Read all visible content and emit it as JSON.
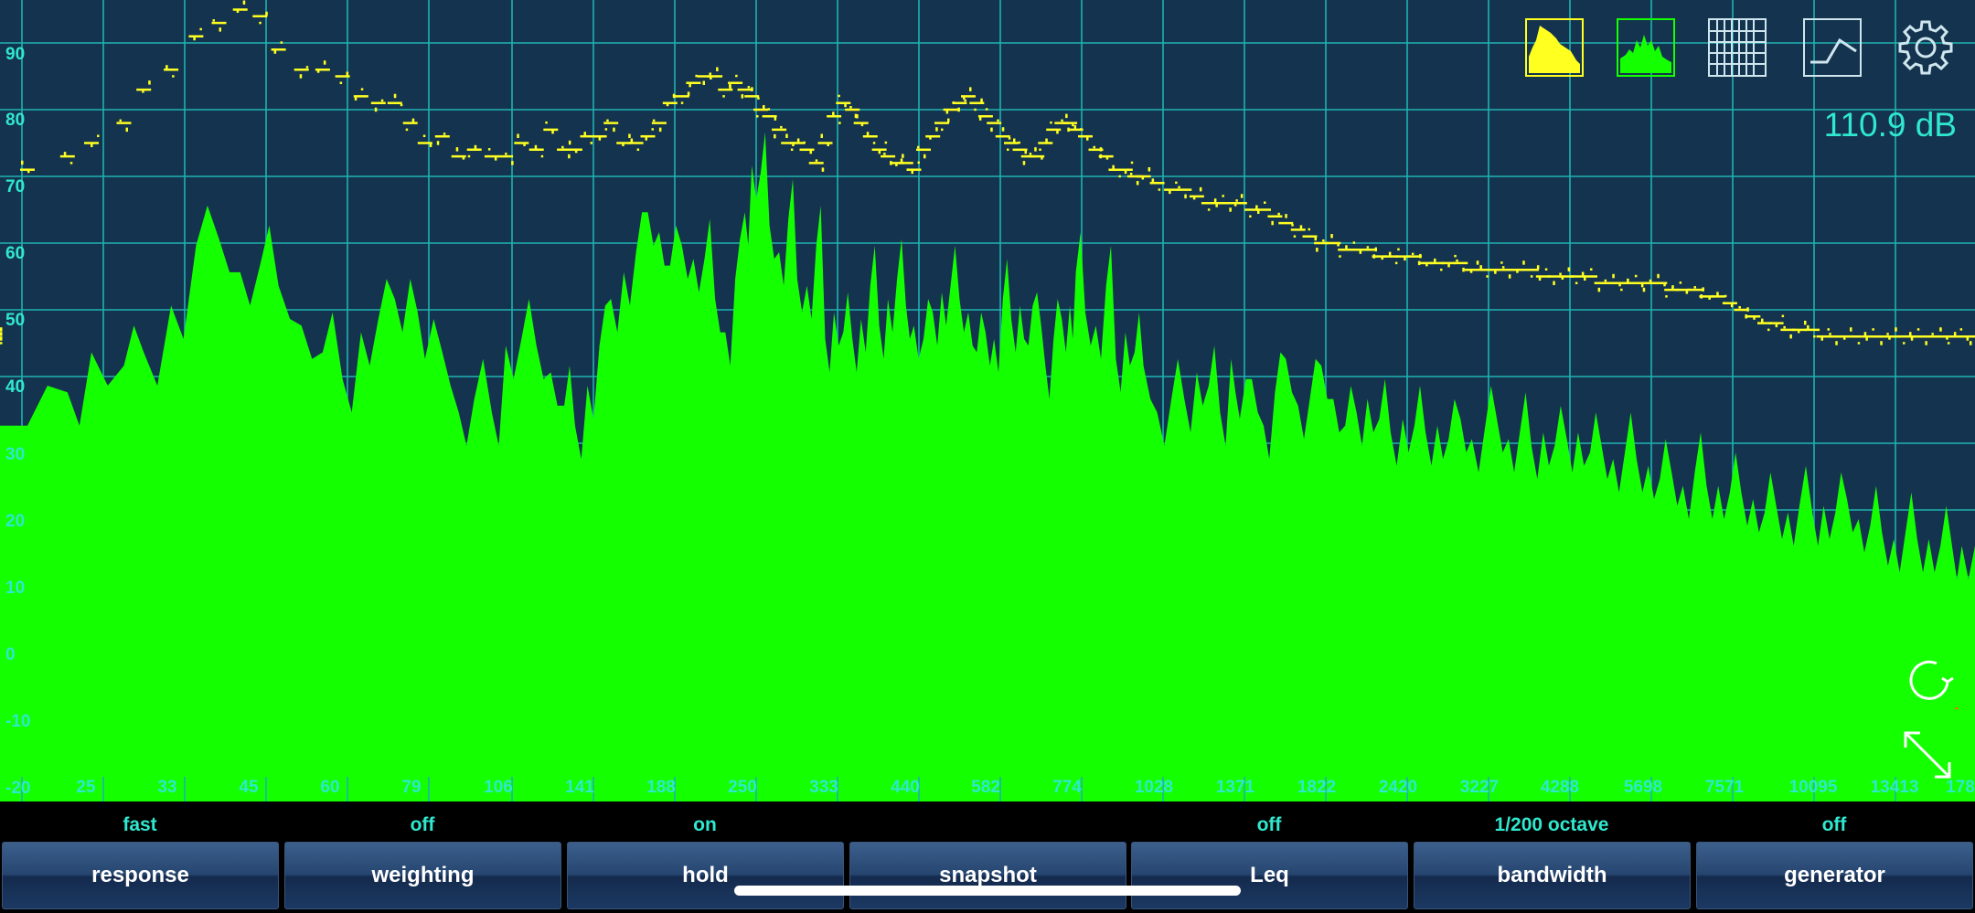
{
  "colors": {
    "background": "#14334f",
    "grid": "#1fb3b0",
    "spectrum": "#14ff00",
    "peak_hold": "#ffff20",
    "label": "#2fe8cf"
  },
  "toolbar": {
    "icons": [
      {
        "name": "yellow-spectrum-icon"
      },
      {
        "name": "green-spectrum-icon"
      },
      {
        "name": "grid-icon"
      },
      {
        "name": "curve-icon"
      },
      {
        "name": "gear-icon"
      }
    ],
    "db_readout": "110.9 dB"
  },
  "controls": {
    "icons": [
      {
        "name": "reset-icon"
      },
      {
        "name": "expand-icon"
      }
    ]
  },
  "chart_data": {
    "type": "area",
    "y_ticks": [
      "90",
      "80",
      "70",
      "60",
      "50",
      "40",
      "30",
      "20",
      "10",
      "0",
      "-10",
      "-20"
    ],
    "x_ticks": [
      "25",
      "33",
      "45",
      "60",
      "79",
      "106",
      "141",
      "188",
      "250",
      "333",
      "440",
      "582",
      "774",
      "1028",
      "1371",
      "1822",
      "2420",
      "3227",
      "4288",
      "5698",
      "7571",
      "10095",
      "13413",
      "178"
    ],
    "ylim": [
      -20,
      95
    ],
    "grid": true,
    "series": [
      {
        "x": [
          20,
          23,
          25,
          28,
          30,
          33,
          36,
          39,
          42,
          45,
          48,
          52,
          56,
          60,
          64,
          68,
          72,
          76,
          80,
          85,
          90,
          95,
          101,
          106,
          112,
          118,
          124,
          130,
          135,
          141,
          147,
          153,
          160,
          167,
          174,
          181,
          188,
          196,
          204,
          212,
          220,
          228,
          236,
          244,
          250,
          258,
          266,
          275,
          284,
          293,
          303,
          313,
          323,
          333,
          344,
          355,
          366,
          378,
          390,
          402,
          415,
          428,
          440,
          455,
          470,
          485,
          500,
          516,
          532,
          548,
          565,
          582,
          600,
          618,
          637,
          656,
          676,
          696,
          716,
          737,
          758,
          774,
          800,
          830,
          860,
          890,
          920,
          950,
          980,
          1028,
          1080,
          1130,
          1180,
          1230,
          1280,
          1330,
          1371,
          1430,
          1490,
          1550,
          1610,
          1680,
          1750,
          1822,
          1900,
          1980,
          2060,
          2140,
          2230,
          2320,
          2420,
          2520,
          2620,
          2730,
          2840,
          2960,
          3080,
          3227,
          3360,
          3500,
          3640,
          3790,
          3950,
          4110,
          4288,
          4460,
          4650,
          4840,
          5040,
          5250,
          5470,
          5698,
          5930,
          6180,
          6430,
          6700,
          6980,
          7270,
          7571,
          7880,
          8210,
          8550,
          8900,
          9270,
          9650,
          10095,
          10500,
          10940,
          11390,
          11860,
          12350,
          12870,
          13413,
          13970,
          14550,
          15150,
          15780,
          16430,
          17000,
          17800
        ],
        "values": [
          34,
          39,
          45,
          43,
          45,
          52,
          61,
          62,
          57,
          58,
          55,
          49,
          45,
          41,
          48,
          50,
          53,
          56,
          44,
          45,
          36,
          38,
          36,
          46,
          47,
          46,
          42,
          37,
          34,
          40,
          46,
          53,
          57,
          60,
          66,
          63,
          58,
          61,
          59,
          59,
          53,
          48,
          56,
          66,
          73,
          72,
          64,
          60,
          65,
          56,
          55,
          61,
          47,
          51,
          48,
          47,
          50,
          55,
          49,
          53,
          56,
          52,
          49,
          47,
          51,
          54,
          55,
          53,
          51,
          45,
          48,
          47,
          53,
          50,
          52,
          46,
          54,
          43,
          47,
          50,
          52,
          57,
          51,
          49,
          55,
          44,
          48,
          45,
          43,
          36,
          38,
          38,
          42,
          40,
          36,
          44,
          35,
          41,
          34,
          39,
          44,
          37,
          38,
          43,
          38,
          34,
          36,
          38,
          35,
          33,
          35,
          34,
          33,
          34,
          32,
          35,
          32,
          34,
          35,
          32,
          33,
          31,
          33,
          31,
          32,
          33,
          30,
          31,
          29,
          30,
          29,
          28,
          26,
          27,
          25,
          27,
          25,
          25,
          24,
          24,
          23,
          21,
          22,
          21,
          22,
          21,
          22,
          21,
          23,
          20,
          19,
          18,
          17,
          18,
          17,
          17,
          16,
          16,
          16,
          16
        ],
        "peaks": [
          71,
          73,
          75,
          78,
          83,
          86,
          91,
          93,
          95,
          94,
          89,
          86,
          86,
          85,
          82,
          81,
          81,
          78,
          75,
          76,
          73,
          74,
          73,
          73,
          75,
          74,
          77,
          74,
          74,
          76,
          76,
          78,
          75,
          75,
          76,
          78,
          81,
          82,
          84,
          85,
          85,
          83,
          84,
          83,
          82,
          80,
          79,
          77,
          75,
          75,
          74,
          72,
          75,
          79,
          81,
          80,
          78,
          76,
          74,
          73,
          72,
          72,
          71,
          74,
          76,
          78,
          80,
          81,
          82,
          81,
          79,
          78,
          76,
          75,
          74,
          73,
          73,
          75,
          77,
          78,
          78,
          77,
          76,
          74,
          73,
          71,
          71,
          70,
          70,
          69,
          68,
          68,
          67,
          66,
          66,
          66,
          66,
          65,
          65,
          64,
          63,
          62,
          61,
          60,
          60,
          59,
          59,
          59,
          58,
          58,
          58,
          58,
          57,
          57,
          57,
          57,
          56,
          56,
          56,
          56,
          56,
          56,
          55,
          55,
          55,
          55,
          55,
          54,
          54,
          54,
          54,
          54,
          54,
          53,
          53,
          53,
          52,
          52,
          51,
          50,
          49,
          48,
          48,
          47,
          47,
          47,
          46,
          46,
          46,
          46,
          46,
          46,
          46,
          46,
          46,
          46,
          46,
          46,
          46,
          46,
          46,
          46,
          46
        ]
      }
    ]
  },
  "status": {
    "response": "fast",
    "weighting": "off",
    "hold": "on",
    "snapshot": "",
    "leq": "off",
    "bandwidth": "1/200 octave",
    "generator": "off"
  },
  "buttons": {
    "response": "response",
    "weighting": "weighting",
    "hold": "hold",
    "snapshot": "snapshot",
    "leq": "Leq",
    "bandwidth": "bandwidth",
    "generator": "generator"
  }
}
